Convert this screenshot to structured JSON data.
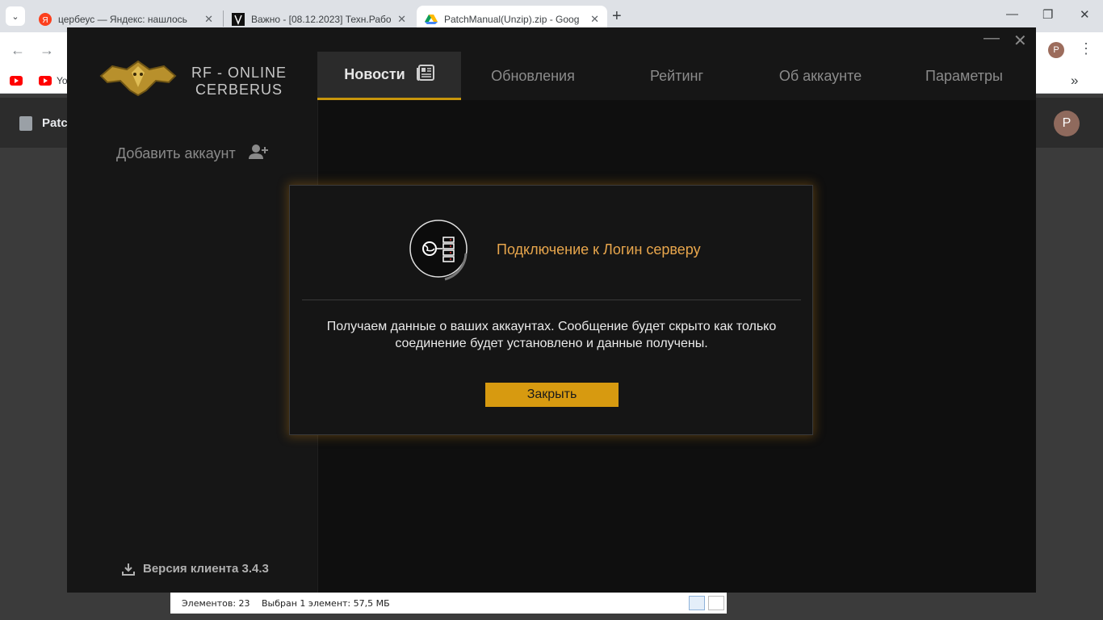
{
  "browser": {
    "tabs": [
      {
        "title": "цербеус — Яндекс: нашлось",
        "favicon": "yandex-icon"
      },
      {
        "title": "Важно - [08.12.2023] Техн.Рабо",
        "favicon": "rf-icon"
      },
      {
        "title": "PatchManual(Unzip).zip - Goog",
        "favicon": "google-drive-icon"
      }
    ],
    "avatar_letter": "P",
    "bookmark_label": "Yo"
  },
  "drive": {
    "title": "Patc",
    "avatar_letter": "P"
  },
  "explorer_status": {
    "items_count": "Элементов: 23",
    "selection": "Выбран 1 элемент: 57,5 МБ"
  },
  "launcher": {
    "logo_line1": "RF - ONLINE",
    "logo_line2": "CERBERUS",
    "nav": [
      "Новости",
      "Обновления",
      "Рейтинг",
      "Об аккаунте",
      "Параметры"
    ],
    "add_account": "Добавить аккаунт",
    "version": "Версия клиента 3.4.3",
    "accent_color": "#d79a10"
  },
  "modal": {
    "title": "Подключение к Логин серверу",
    "body_line1": "Получаем данные о ваших аккаунтах. Сообщение будет скрыто как только",
    "body_line2": "соединение будет установлено и данные получены.",
    "close_button": "Закрыть"
  }
}
